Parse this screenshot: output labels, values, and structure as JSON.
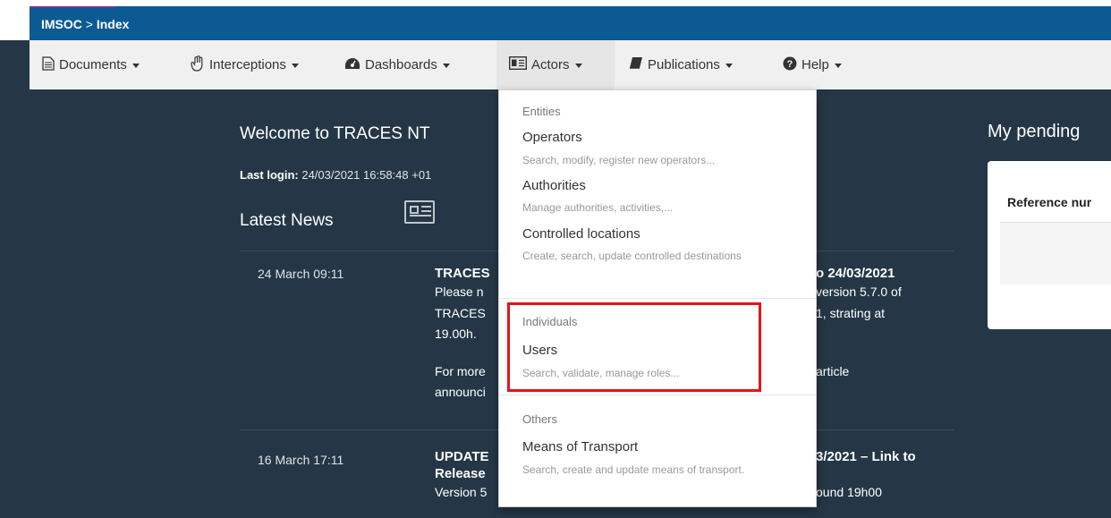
{
  "breadcrumb": {
    "app": "IMSOC",
    "sep": ">",
    "page": "Index"
  },
  "nav": [
    {
      "label": "Documents",
      "icon": "document-icon"
    },
    {
      "label": "Interceptions",
      "icon": "hand-icon"
    },
    {
      "label": "Dashboards",
      "icon": "dashboard-icon"
    },
    {
      "label": "Actors",
      "icon": "id-card-icon"
    },
    {
      "label": "Publications",
      "icon": "book-icon"
    },
    {
      "label": "Help",
      "icon": "question-icon"
    }
  ],
  "main": {
    "welcome": "Welcome to TRACES NT",
    "last_login_label": "Last login:",
    "last_login_value": "24/03/2021 16:58:48 +01",
    "news_title": "Latest News",
    "news": [
      {
        "date": "24 March 09:11",
        "title_left": "TRACES",
        "title_right": "o 24/03/2021",
        "line2_left": "Please n",
        "line2_right": "version 5.7.0 of",
        "line3_left": "TRACES",
        "line3_right": "1, strating at",
        "line4": "19.00h.",
        "line5_left": "For more",
        "line5_right": "article",
        "line6_left": "announci"
      },
      {
        "date": "16 March 17:11",
        "title_left": "UPDATE",
        "title_right": "3/2021 – Link to",
        "line2_left": "Release",
        "line3_left": "Version 5",
        "line3_right": "ound 19h00"
      }
    ]
  },
  "pending": {
    "title": "My pending",
    "column_header": "Reference nur"
  },
  "dropdown": {
    "sections": [
      {
        "header": "Entities",
        "items": [
          {
            "title": "Operators",
            "desc": "Search, modify, register new operators..."
          },
          {
            "title": "Authorities",
            "desc": "Manage authorities, activities,..."
          },
          {
            "title": "Controlled locations",
            "desc": "Create, search, update controlled destinations"
          }
        ]
      },
      {
        "header": "Individuals",
        "items": [
          {
            "title": "Users",
            "desc": "Search, validate, manage roles..."
          }
        ]
      },
      {
        "header": "Others",
        "items": [
          {
            "title": "Means of Transport",
            "desc": "Search, create and update means of transport."
          }
        ]
      }
    ]
  },
  "colors": {
    "background": "#253746",
    "topbar": "#0c5a94",
    "highlight": "#e0161c"
  }
}
